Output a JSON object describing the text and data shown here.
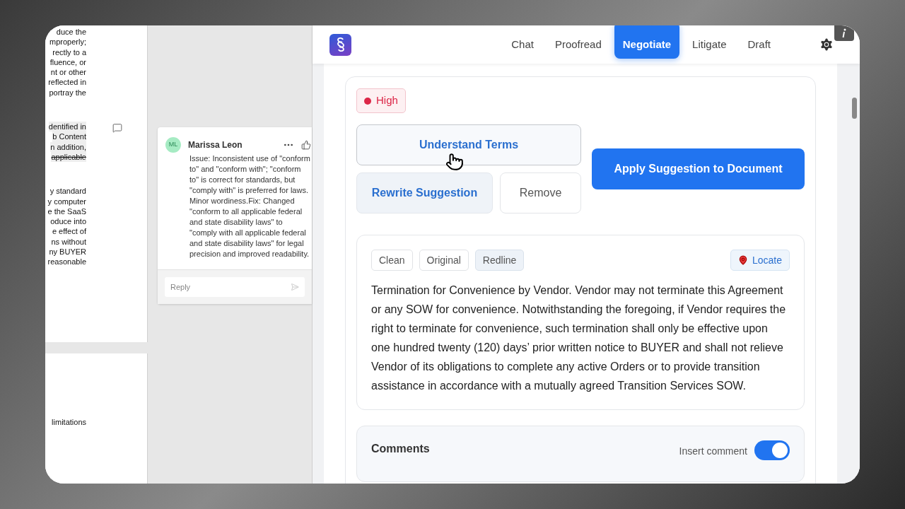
{
  "document": {
    "pages": [
      {
        "blocks": [
          {
            "lines": [
              {
                "text": "duce the"
              },
              {
                "text": "mproperly;"
              },
              {
                "text": "rectly to a"
              },
              {
                "text": "fluence, or"
              },
              {
                "text": "nt or other"
              },
              {
                "text": "reflected in"
              },
              {
                "text": "portray the"
              }
            ]
          },
          {
            "lines": [
              {
                "text": "dentified in",
                "highlighted": true
              },
              {
                "text": "b Content",
                "highlighted": true
              },
              {
                "text": "n addition,",
                "highlighted": true
              },
              {
                "text": "applicable",
                "highlighted": true,
                "struck": true
              }
            ],
            "has_comment": true
          },
          {
            "lines": [
              {
                "text": "y standard"
              },
              {
                "text": "y computer"
              },
              {
                "text": "e the SaaS"
              },
              {
                "text": "oduce into"
              },
              {
                "text": "e effect of"
              },
              {
                "text": "ns without"
              },
              {
                "text": "ny BUYER"
              },
              {
                "text": "reasonable"
              }
            ]
          }
        ]
      },
      {
        "blocks": [
          {
            "lines": [
              {
                "text": "limitations"
              }
            ]
          }
        ]
      }
    ]
  },
  "comment": {
    "initials": "ML",
    "author": "Marissa Leon",
    "body": "Issue: Inconsistent use of \"conform to\" and \"conform with\"; \"conform to\" is correct for standards, but \"comply with\" is preferred for laws. Minor wordiness.Fix: Changed \"conform to all applicable federal and state disability laws\" to \"comply with all applicable federal and state disability laws\" for legal precision and improved readability.",
    "reply_placeholder": "Reply"
  },
  "nav": {
    "tabs": [
      {
        "label": "Chat",
        "selected": false
      },
      {
        "label": "Proofread",
        "selected": false
      },
      {
        "label": "Negotiate",
        "selected": true
      },
      {
        "label": "Litigate",
        "selected": false
      },
      {
        "label": "Draft",
        "selected": false
      }
    ]
  },
  "suggestion": {
    "severity": {
      "label": "High",
      "color": "#dc2647"
    },
    "buttons": {
      "understand": "Understand Terms",
      "rewrite": "Rewrite Suggestion",
      "remove": "Remove",
      "apply": "Apply Suggestion to Document"
    },
    "views": [
      {
        "label": "Clean",
        "selected": false
      },
      {
        "label": "Original",
        "selected": false
      },
      {
        "label": "Redline",
        "selected": true
      }
    ],
    "locate": "Locate",
    "text": "Termination for Convenience by Vendor. Vendor may not terminate this Agreement or any SOW for convenience. Notwithstanding the foregoing, if Vendor requires the right to terminate for convenience, such termination shall only be effective upon one hundred twenty (120) days’ prior written notice to BUYER and shall not relieve Vendor of its obligations to complete any active Orders or to provide transition assistance in accordance with a mutually agreed Transition Services SOW."
  },
  "comments": {
    "title": "Comments",
    "insert_label": "Insert comment",
    "insert_on": true
  }
}
